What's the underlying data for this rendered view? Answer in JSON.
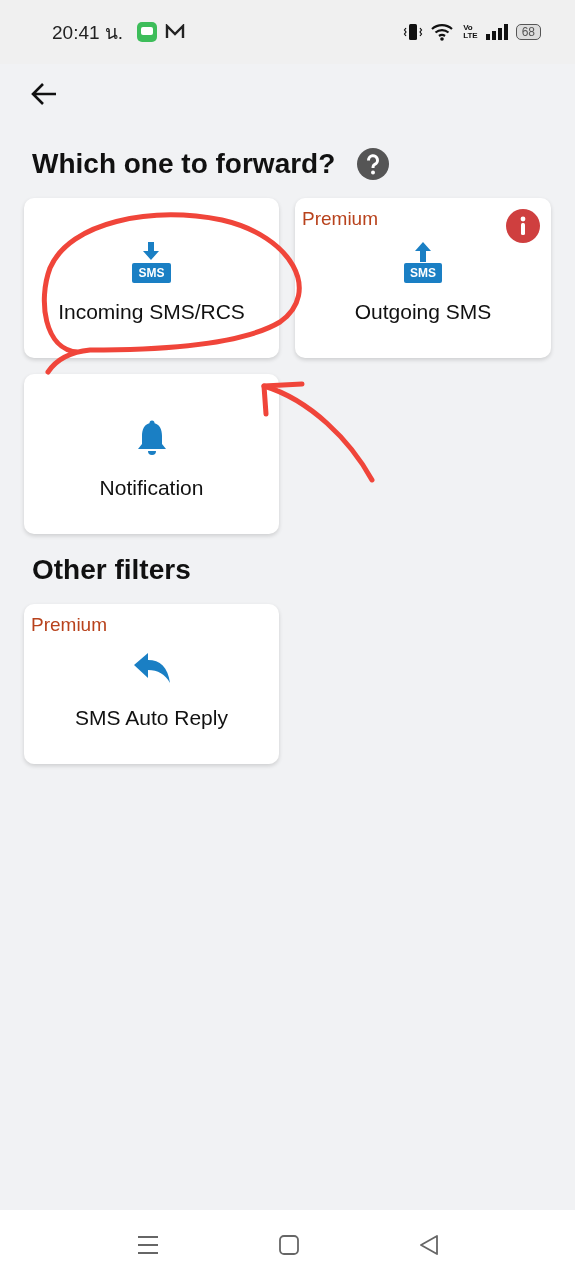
{
  "status_bar": {
    "time": "20:41 น.",
    "volte": [
      "Vo",
      "LTE"
    ],
    "battery": "68"
  },
  "sections": [
    {
      "title": "Which one to forward?",
      "help": true,
      "cards": [
        {
          "label": "Incoming SMS/RCS",
          "kind": "download",
          "icon_text": "SMS",
          "info": false
        },
        {
          "label": "Outgoing SMS",
          "kind": "upload",
          "icon_text": "SMS",
          "badge": "Premium",
          "info": true
        },
        {
          "label": "Notification",
          "kind": "bell",
          "info": false
        }
      ]
    },
    {
      "title": "Other filters",
      "help": false,
      "cards": [
        {
          "label": "SMS Auto Reply",
          "kind": "reply",
          "badge": "Premium",
          "info": false
        }
      ]
    }
  ]
}
